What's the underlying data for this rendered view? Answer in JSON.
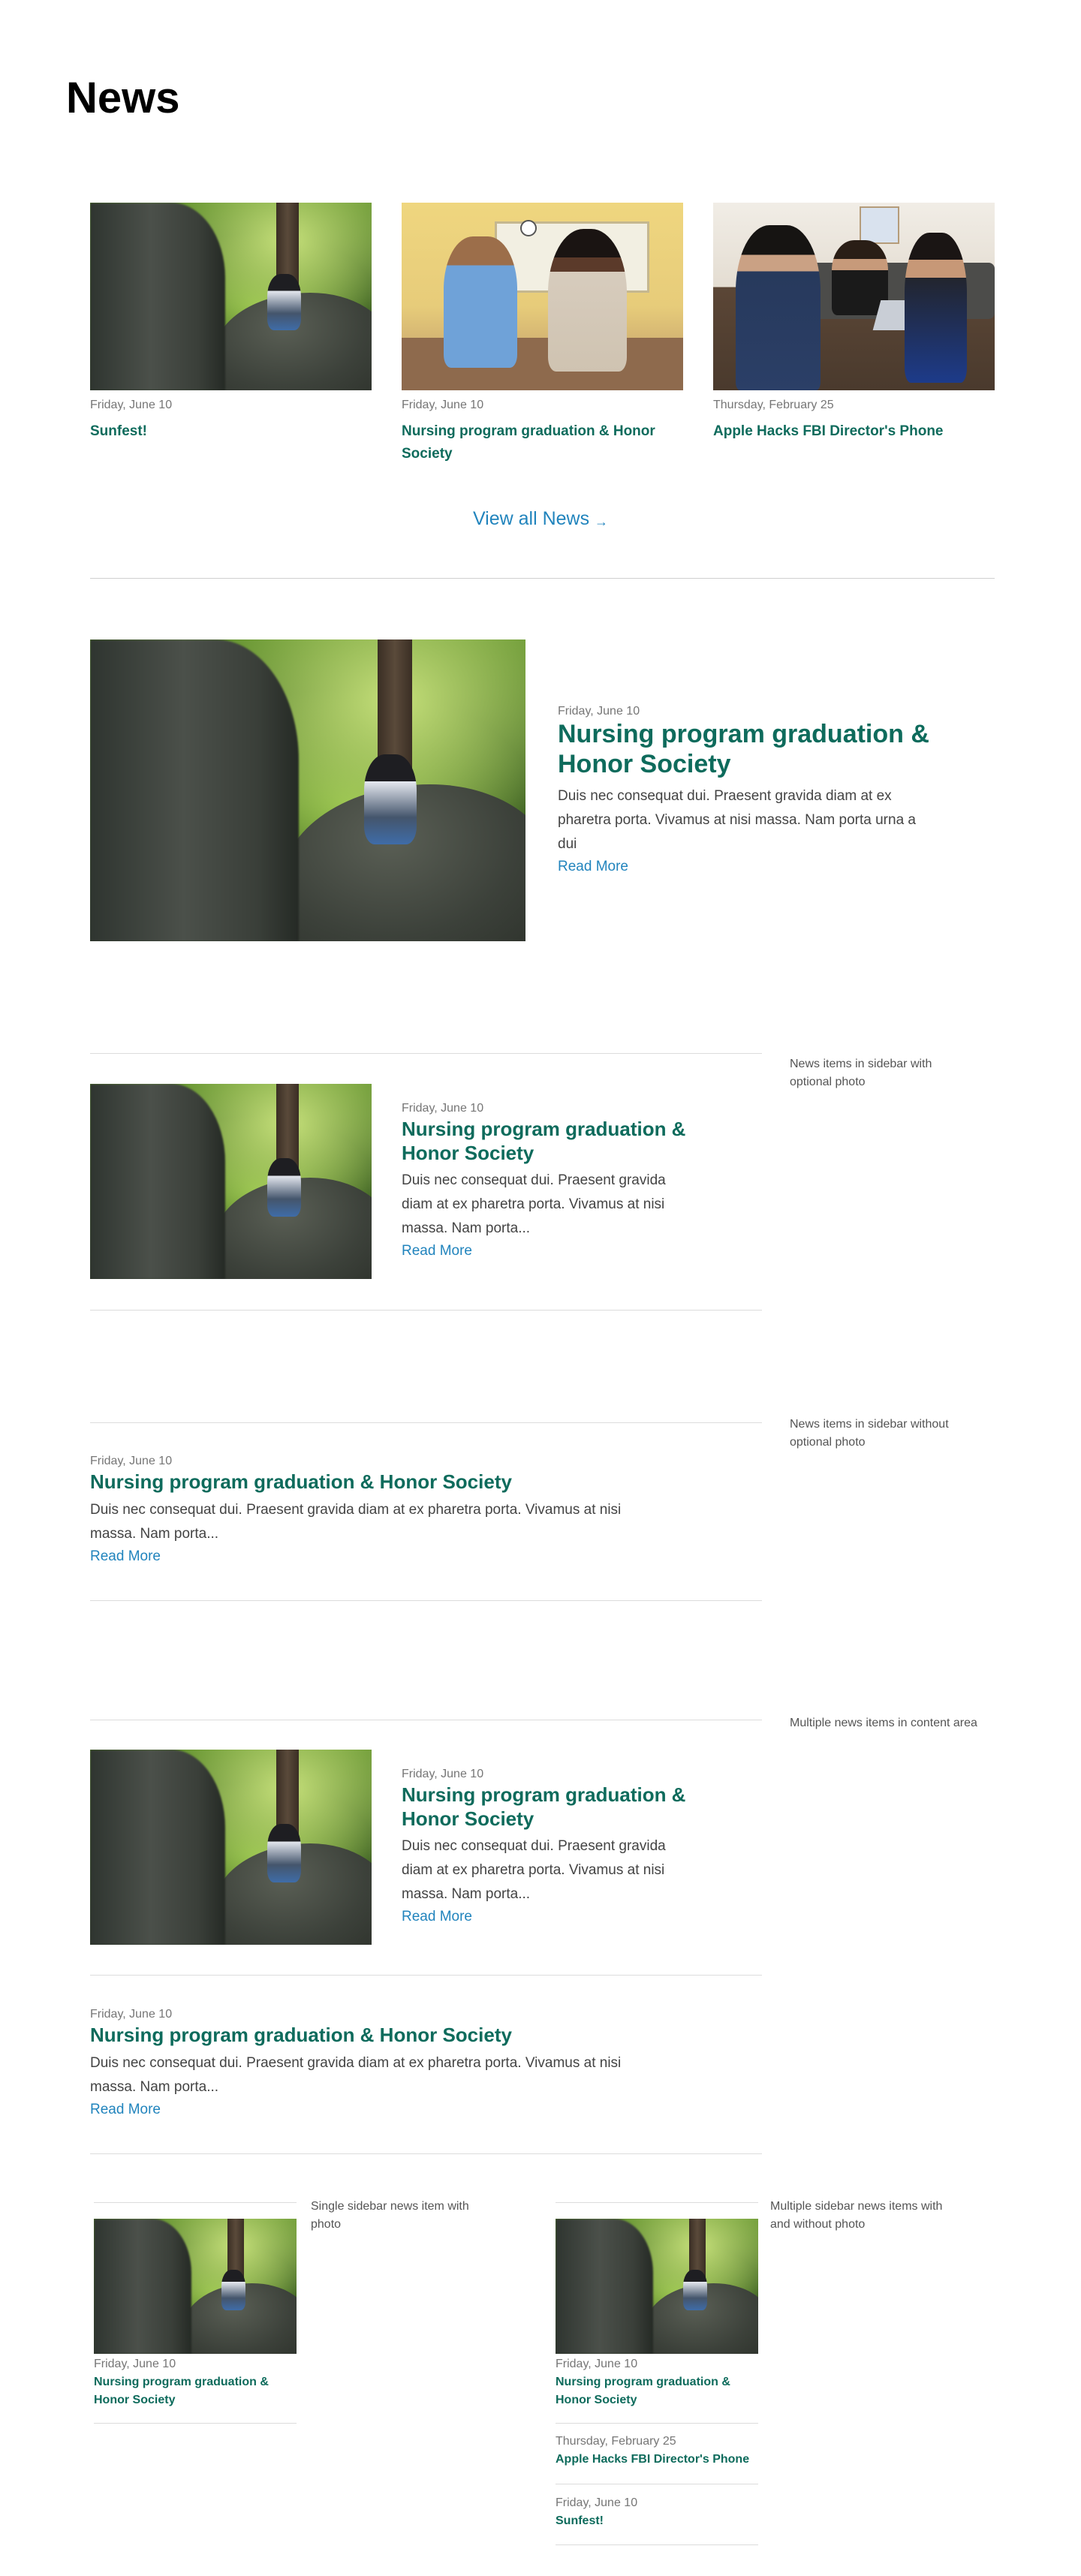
{
  "page": {
    "title": "News"
  },
  "top_cards": [
    {
      "date": "Friday, June 10",
      "title": "Sunfest!"
    },
    {
      "date": "Friday, June 10",
      "title": "Nursing program graduation & Honor Society"
    },
    {
      "date": "Thursday, February 25",
      "title": "Apple Hacks FBI Director's Phone"
    }
  ],
  "view_all": {
    "label": "View all News",
    "arrow": "→"
  },
  "feature": {
    "date": "Friday, June 10",
    "title": "Nursing program graduation & Honor Society",
    "body": "Duis nec consequat dui. Praesent gravida diam at ex pharetra porta. Vivamus at nisi massa. Nam porta urna a dui",
    "more": "Read More"
  },
  "sidebar_photo": {
    "note": "News items in sidebar with optional photo",
    "date": "Friday, June 10",
    "title": "Nursing program graduation & Honor Society",
    "body": "Duis nec consequat dui. Praesent gravida diam at ex pharetra porta. Vivamus at nisi massa. Nam porta...",
    "more": "Read More"
  },
  "sidebar_nophoto": {
    "note": "News items in sidebar without optional photo",
    "date": "Friday, June 10",
    "title": "Nursing program graduation & Honor Society",
    "body": "Duis nec consequat dui. Praesent gravida diam at ex pharetra porta. Vivamus at nisi massa. Nam porta...",
    "more": "Read More"
  },
  "multiple": {
    "note": "Multiple news items in content area",
    "item1": {
      "date": "Friday, June 10",
      "title": "Nursing program graduation & Honor Society",
      "body": "Duis nec consequat dui. Praesent gravida diam at ex pharetra porta. Vivamus at nisi massa. Nam porta...",
      "more": "Read More"
    },
    "item2": {
      "date": "Friday, June 10",
      "title": "Nursing program graduation & Honor Society",
      "body": "Duis nec consequat dui. Praesent gravida diam at ex pharetra porta. Vivamus at nisi massa. Nam porta...",
      "more": "Read More"
    }
  },
  "single_sidebar": {
    "note": "Single sidebar news item with photo",
    "date": "Friday, June 10",
    "title": "Nursing program graduation & Honor Society"
  },
  "multi_sidebar": {
    "note": "Multiple sidebar news items with and without photo",
    "items": [
      {
        "date": "Friday, June 10",
        "title": "Nursing program graduation & Honor Society"
      },
      {
        "date": "Thursday, February 25",
        "title": "Apple Hacks FBI Director's Phone"
      },
      {
        "date": "Friday, June 10",
        "title": "Sunfest!"
      }
    ]
  },
  "colors": {
    "heading": "#000000",
    "title_green": "#0e6b5c",
    "link_blue": "#2184bd",
    "date_gray": "#767676",
    "rule": "#dcdcdc"
  },
  "icons": {
    "view_all_arrow": "arrow-right-icon"
  }
}
